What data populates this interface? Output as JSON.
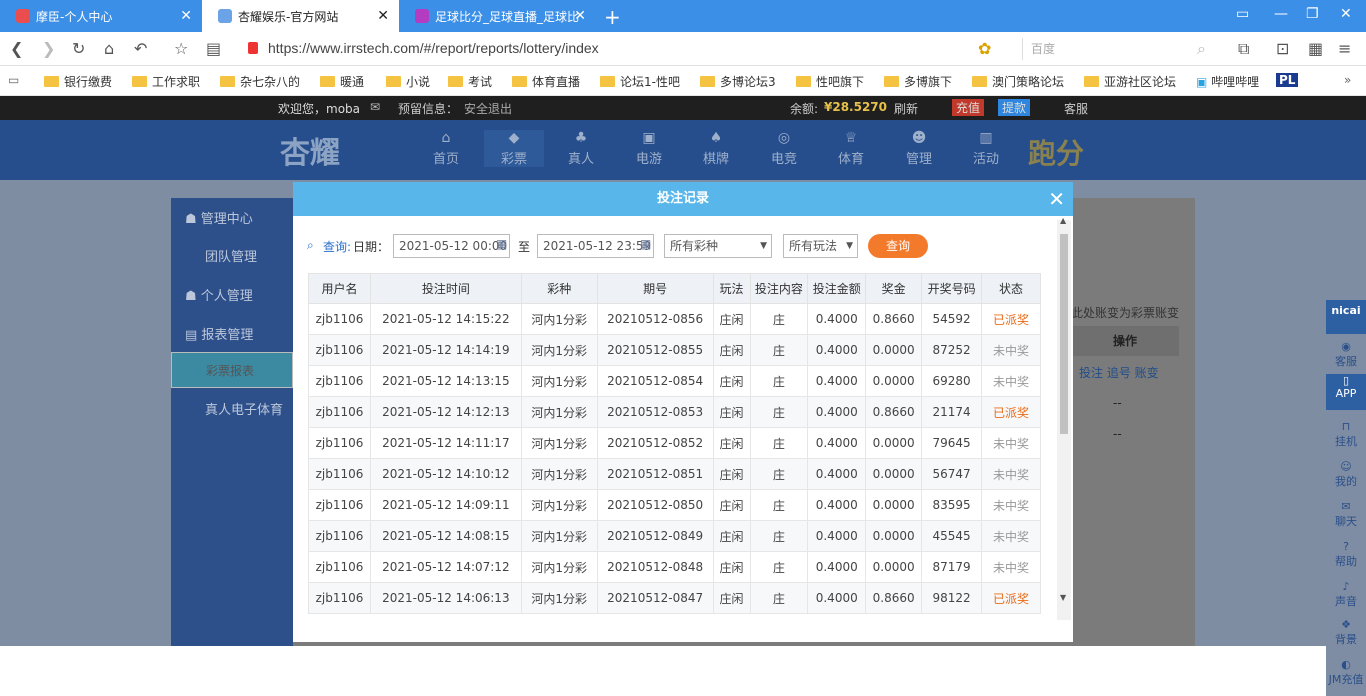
{
  "browser": {
    "tabs": [
      {
        "title": "摩臣-个人中心"
      },
      {
        "title": "杏耀娱乐-官方网站"
      },
      {
        "title": "足球比分_足球直播_足球比"
      }
    ],
    "url": "https://www.irrstech.com/#/report/reports/lottery/index",
    "search_placeholder": "百度",
    "bookmarks": [
      "银行缴费",
      "工作求职",
      "杂七杂八的",
      "暖通",
      "小说",
      "考试",
      "体育直播",
      "论坛1-性吧",
      "多博论坛3",
      "性吧旗下",
      "多博旗下",
      "澳门策略论坛",
      "亚游社区论坛",
      "哔哩哔哩",
      "PL"
    ]
  },
  "site": {
    "welcome": "欢迎您，moba",
    "notice_label": "预留信息：",
    "notice_value": "安全退出",
    "balance_label": "余额:",
    "balance_value": "¥28.5270",
    "refresh": "刷新",
    "deposit": "充值",
    "withdraw": "提款",
    "service": "客服",
    "logo": "杏耀",
    "paofen": "跑分",
    "nav": [
      {
        "icon": "home-icon",
        "label": "首页"
      },
      {
        "icon": "lottery-icon",
        "label": "彩票"
      },
      {
        "icon": "live-icon",
        "label": "真人"
      },
      {
        "icon": "slot-icon",
        "label": "电游"
      },
      {
        "icon": "chess-icon",
        "label": "棋牌"
      },
      {
        "icon": "esports-icon",
        "label": "电竞"
      },
      {
        "icon": "sports-icon",
        "label": "体育"
      },
      {
        "icon": "manage-icon",
        "label": "管理"
      },
      {
        "icon": "activity-icon",
        "label": "活动"
      }
    ],
    "left_menu": [
      "管理中心",
      "团队管理",
      "个人管理",
      "报表管理",
      "彩票报表",
      "真人电子体育"
    ],
    "right_hint": "此处账变为彩票账变",
    "right_col_header": "操作",
    "right_row_action": "投注 追号 账变",
    "right_dash": "--",
    "sidebar": [
      "nicai",
      "客服",
      "APP",
      "挂机",
      "我的",
      "聊天",
      "帮助",
      "声音",
      "背景",
      "JM充值"
    ]
  },
  "modal": {
    "title": "投注记录",
    "query_label": "查询:",
    "date_label": "日期：",
    "date_from": "2021-05-12 00:00",
    "to": "至",
    "date_to": "2021-05-12 23:59",
    "lottery_select": "所有彩种",
    "play_select": "所有玩法",
    "query_button": "查询",
    "columns": [
      "用户名",
      "投注时间",
      "彩种",
      "期号",
      "玩法",
      "投注内容",
      "投注金额",
      "奖金",
      "开奖号码",
      "状态"
    ],
    "rows": [
      [
        "zjb1106",
        "2021-05-12 14:15:22",
        "河内1分彩",
        "20210512-0856",
        "庄闲",
        "庄",
        "0.4000",
        "0.8660",
        "54592",
        "已派奖"
      ],
      [
        "zjb1106",
        "2021-05-12 14:14:19",
        "河内1分彩",
        "20210512-0855",
        "庄闲",
        "庄",
        "0.4000",
        "0.0000",
        "87252",
        "未中奖"
      ],
      [
        "zjb1106",
        "2021-05-12 14:13:15",
        "河内1分彩",
        "20210512-0854",
        "庄闲",
        "庄",
        "0.4000",
        "0.0000",
        "69280",
        "未中奖"
      ],
      [
        "zjb1106",
        "2021-05-12 14:12:13",
        "河内1分彩",
        "20210512-0853",
        "庄闲",
        "庄",
        "0.4000",
        "0.8660",
        "21174",
        "已派奖"
      ],
      [
        "zjb1106",
        "2021-05-12 14:11:17",
        "河内1分彩",
        "20210512-0852",
        "庄闲",
        "庄",
        "0.4000",
        "0.0000",
        "79645",
        "未中奖"
      ],
      [
        "zjb1106",
        "2021-05-12 14:10:12",
        "河内1分彩",
        "20210512-0851",
        "庄闲",
        "庄",
        "0.4000",
        "0.0000",
        "56747",
        "未中奖"
      ],
      [
        "zjb1106",
        "2021-05-12 14:09:11",
        "河内1分彩",
        "20210512-0850",
        "庄闲",
        "庄",
        "0.4000",
        "0.0000",
        "83595",
        "未中奖"
      ],
      [
        "zjb1106",
        "2021-05-12 14:08:15",
        "河内1分彩",
        "20210512-0849",
        "庄闲",
        "庄",
        "0.4000",
        "0.0000",
        "45545",
        "未中奖"
      ],
      [
        "zjb1106",
        "2021-05-12 14:07:12",
        "河内1分彩",
        "20210512-0848",
        "庄闲",
        "庄",
        "0.4000",
        "0.0000",
        "87179",
        "未中奖"
      ],
      [
        "zjb1106",
        "2021-05-12 14:06:13",
        "河内1分彩",
        "20210512-0847",
        "庄闲",
        "庄",
        "0.4000",
        "0.8660",
        "98122",
        "已派奖"
      ]
    ]
  }
}
